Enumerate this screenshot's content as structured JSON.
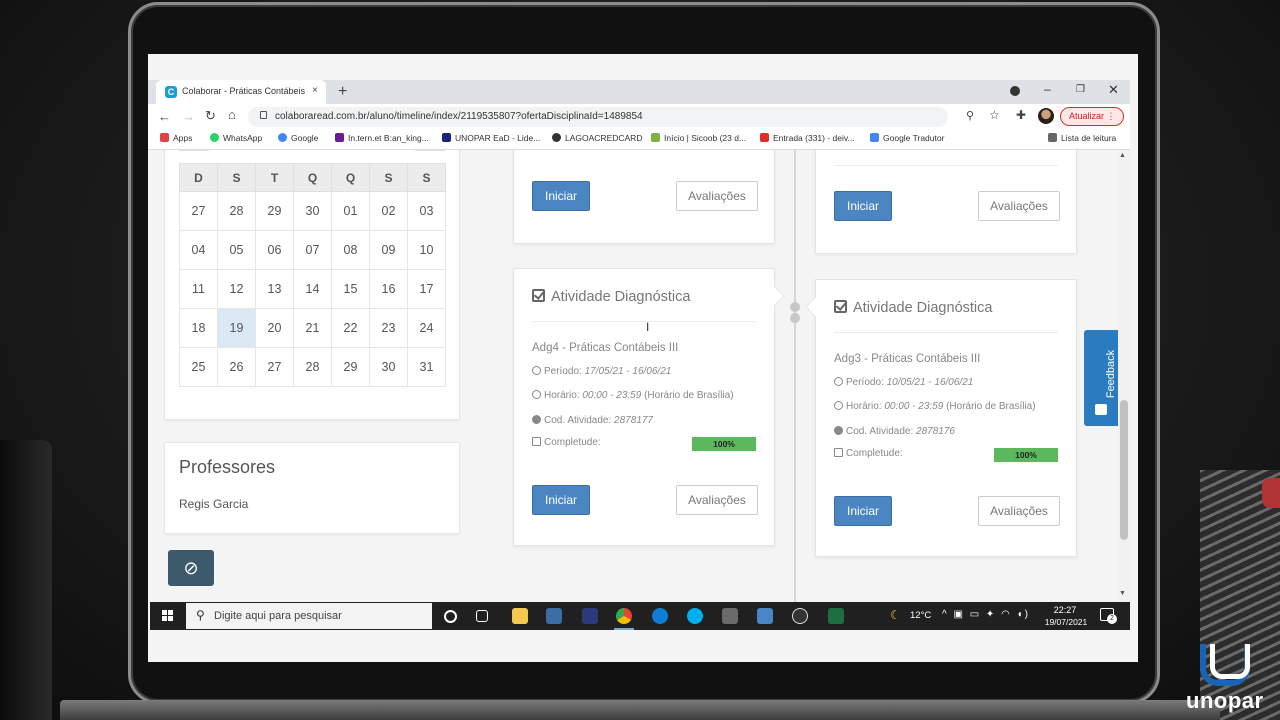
{
  "browser": {
    "tab_title": "Colaborar - Práticas Contábeis II",
    "tab_close": "×",
    "new_tab": "+",
    "url": "colaboraread.com.br/aluno/timeline/index/2119535807?ofertaDisciplinaId=1489854",
    "update_label": "Atualizar"
  },
  "bookmarks": [
    {
      "label": "Apps",
      "color": "#d44"
    },
    {
      "label": "WhatsApp",
      "color": "#25d366"
    },
    {
      "label": "Google",
      "color": "#4285f4"
    },
    {
      "label": "In.tern.et B:an_king...",
      "color": "#6a1b9a"
    },
    {
      "label": "UNOPAR EaD - Lide...",
      "color": "#1a237e"
    },
    {
      "label": "LAGOACREDCARD",
      "color": "#333"
    },
    {
      "label": "Início | Sicoob (23 d...",
      "color": "#7cb342"
    },
    {
      "label": "Entrada (331) - deiv...",
      "color": "#d93025"
    },
    {
      "label": "Google Tradutor",
      "color": "#4285f4"
    }
  ],
  "reading_list": "Lista de leitura",
  "calendar": {
    "weekdays": [
      "D",
      "S",
      "T",
      "Q",
      "Q",
      "S",
      "S"
    ],
    "weeks": [
      [
        "27",
        "28",
        "29",
        "30",
        "01",
        "02",
        "03"
      ],
      [
        "04",
        "05",
        "06",
        "07",
        "08",
        "09",
        "10"
      ],
      [
        "11",
        "12",
        "13",
        "14",
        "15",
        "16",
        "17"
      ],
      [
        "18",
        "19",
        "20",
        "21",
        "22",
        "23",
        "24"
      ],
      [
        "25",
        "26",
        "27",
        "28",
        "29",
        "30",
        "31"
      ]
    ],
    "today": "19"
  },
  "professores": {
    "title": "Professores",
    "name": "Regis Garcia"
  },
  "buttons": {
    "iniciar": "Iniciar",
    "avaliacoes": "Avaliações"
  },
  "activities": {
    "left": {
      "heading": "Atividade Diagnóstica",
      "name": "Adg4 - Práticas Contábeis III",
      "periodo_label": "Período:",
      "periodo": "17/05/21 - 16/06/21",
      "horario_label": "Horário:",
      "horario": "00:00 - 23:59",
      "horario_tz": "(Horário de Brasília)",
      "cod_label": "Cod. Atividade:",
      "cod": "2878177",
      "completude_label": "Completude:",
      "completude": "100%"
    },
    "right": {
      "heading": "Atividade Diagnóstica",
      "name": "Adg3 - Práticas Contábeis III",
      "periodo_label": "Período:",
      "periodo": "10/05/21 - 16/06/21",
      "horario_label": "Horário:",
      "horario": "00:00 - 23:59",
      "horario_tz": "(Horário de Brasília)",
      "cod_label": "Cod. Atividade:",
      "cod": "2878176",
      "completude_label": "Completude:",
      "completude": "100%"
    }
  },
  "feedback_label": "Feedback",
  "taskbar": {
    "search_placeholder": "Digite aqui para pesquisar",
    "temperature": "12°C",
    "time": "22:27",
    "date": "19/07/2021",
    "notifications": "2"
  },
  "brand": "unopar",
  "colors": {
    "primary_button": "#4b86c2",
    "progress": "#5cb85c",
    "feedback": "#2a7bbf",
    "today_highlight": "#dbe9f4"
  }
}
